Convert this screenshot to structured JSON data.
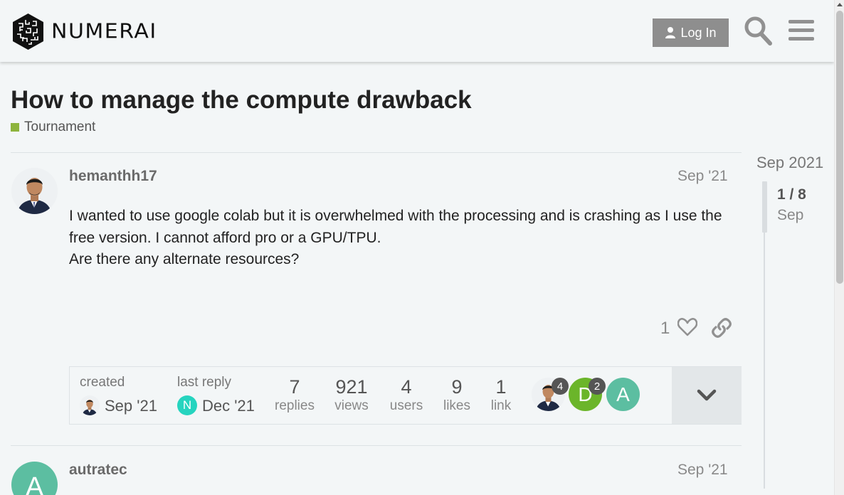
{
  "header": {
    "logo_text": "NUMERAI",
    "login_label": "Log In"
  },
  "topic": {
    "title": "How to manage the compute drawback",
    "category": "Tournament",
    "category_color": "#8eb43d"
  },
  "posts": [
    {
      "username": "hemanthh17",
      "date": "Sep '21",
      "body": [
        "I wanted to use google colab but it is overwhelmed with the processing and is crashing as I use the free version. I cannot afford pro or a GPU/TPU.",
        "Are there any alternate resources?"
      ],
      "likes": "1"
    },
    {
      "username": "autratec",
      "date": "Sep '21",
      "avatar_letter": "A",
      "avatar_color": "#5cbea1"
    }
  ],
  "topic_map": {
    "created_label": "created",
    "created_date": "Sep '21",
    "last_reply_label": "last reply",
    "last_reply_date": "Dec '21",
    "last_reply_avatar_letter": "N",
    "last_reply_avatar_color": "#26d4bf",
    "stats": [
      {
        "num": "7",
        "label": "replies"
      },
      {
        "num": "921",
        "label": "views"
      },
      {
        "num": "4",
        "label": "users"
      },
      {
        "num": "9",
        "label": "likes"
      },
      {
        "num": "1",
        "label": "link"
      }
    ],
    "participants": [
      {
        "type": "photo",
        "count": "4"
      },
      {
        "letter": "D",
        "color": "#6bb52a",
        "count": "2"
      },
      {
        "letter": "A",
        "color": "#5cbea1",
        "count": ""
      }
    ]
  },
  "timeline": {
    "top_date": "Sep 2021",
    "position": "1 / 8",
    "current_date": "Sep"
  }
}
